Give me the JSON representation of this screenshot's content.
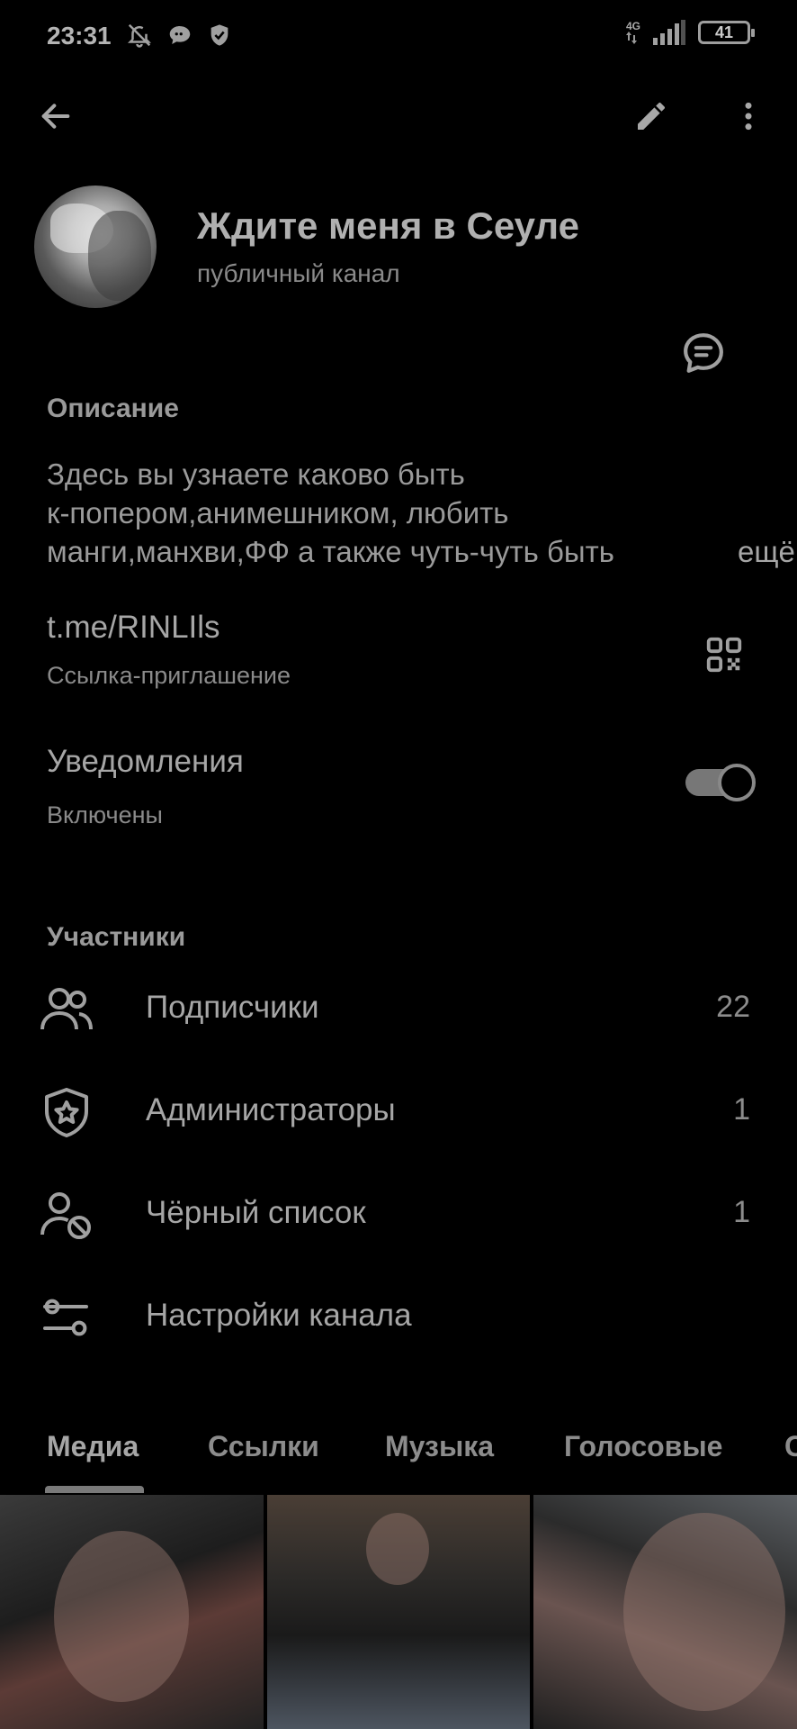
{
  "status_bar": {
    "time": "23:31",
    "network": "4G",
    "battery": "41"
  },
  "toolbar": {
    "back_icon": "arrow-left-icon",
    "edit_icon": "pencil-icon",
    "more_icon": "more-vertical-icon"
  },
  "channel": {
    "title": "Ждите меня в Сеуле",
    "subtitle": "публичный канал"
  },
  "description": {
    "header": "Описание",
    "lines": [
      "Здесь вы узнаете каково быть",
      "к-попером,анимешником, любить",
      "манги,манхви,ФФ а также чуть-чуть быть"
    ],
    "more": "ещё"
  },
  "link": {
    "url": "t.me/RINLIls",
    "caption": "Ссылка-приглашение"
  },
  "notifications": {
    "title": "Уведомления",
    "status": "Включены",
    "enabled": true
  },
  "members": {
    "header": "Участники",
    "rows": [
      {
        "label": "Подписчики",
        "count": "22",
        "icon": "users-icon"
      },
      {
        "label": "Администраторы",
        "count": "1",
        "icon": "shield-star-icon"
      },
      {
        "label": "Чёрный список",
        "count": "1",
        "icon": "user-blocked-icon"
      },
      {
        "label": "Настройки канала",
        "count": "",
        "icon": "sliders-icon"
      }
    ]
  },
  "tabs": [
    "Медиа",
    "Ссылки",
    "Музыка",
    "Голосовые",
    "С"
  ],
  "colors": {
    "background": "#000000",
    "text": "#a6a6a6",
    "muted": "#8a8a8a"
  }
}
